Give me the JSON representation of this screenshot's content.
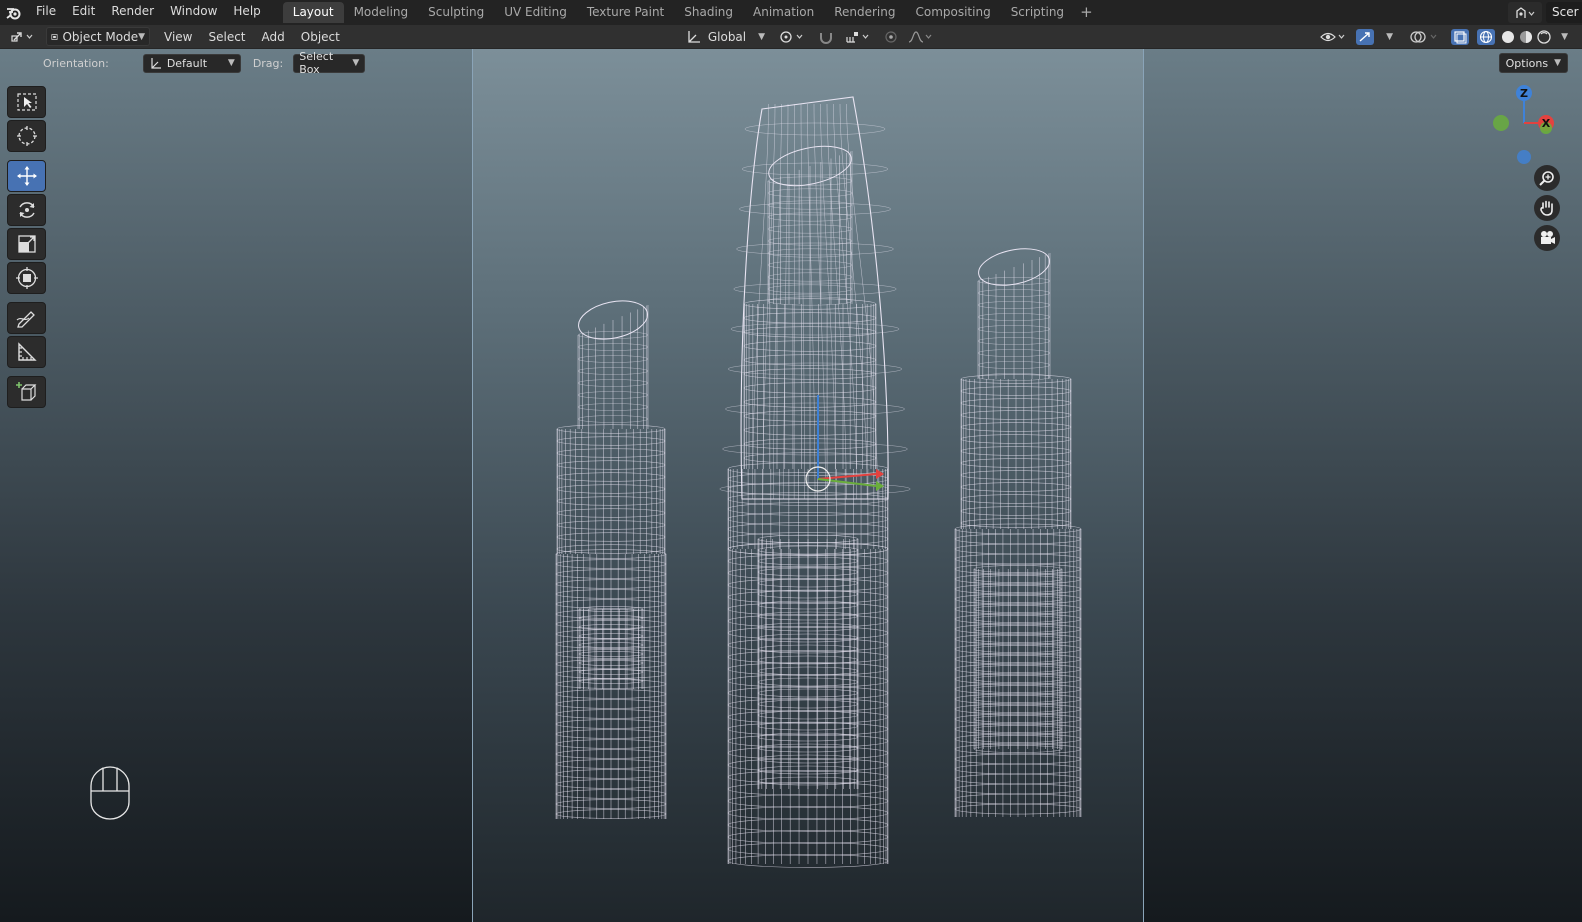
{
  "menu": {
    "items": [
      "File",
      "Edit",
      "Render",
      "Window",
      "Help"
    ]
  },
  "workspaces": {
    "tabs": [
      "Layout",
      "Modeling",
      "Sculpting",
      "UV Editing",
      "Texture Paint",
      "Shading",
      "Animation",
      "Rendering",
      "Compositing",
      "Scripting"
    ],
    "active": "Layout"
  },
  "scene": {
    "name": "Scer"
  },
  "header": {
    "mode": "Object Mode",
    "menus": [
      "View",
      "Select",
      "Add",
      "Object"
    ],
    "transform_orientation": "Global"
  },
  "tool_settings": {
    "orientation_label": "Orientation:",
    "orientation_value": "Default",
    "drag_label": "Drag:",
    "drag_value": "Select Box",
    "options_label": "Options"
  },
  "gizmo": {
    "axis_z": "Z",
    "axis_x": "X",
    "colors": {
      "x": "#e3423f",
      "y": "#6aae3c",
      "z": "#3f82d8"
    }
  },
  "toolbar": {
    "tools": [
      "select-box",
      "cursor",
      "move",
      "rotate",
      "scale",
      "transform",
      "annotate",
      "measure",
      "add-cube"
    ],
    "active": "move"
  },
  "colors": {
    "accent": "#4772b3",
    "camera_frame": "#8aa4b8",
    "wireframe": "#e8e4f2"
  }
}
